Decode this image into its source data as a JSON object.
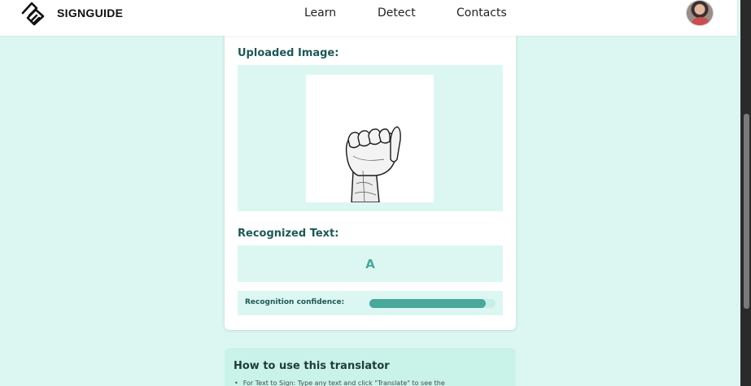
{
  "header": {
    "brand": "SIGNGUIDE",
    "logo_icon": "handshake-logo-icon",
    "nav": [
      {
        "label": "Learn"
      },
      {
        "label": "Detect"
      },
      {
        "label": "Contacts"
      }
    ],
    "avatar_icon": "user-avatar"
  },
  "card": {
    "uploaded_title": "Uploaded Image:",
    "uploaded_image_icon": "asl-letter-a-hand-image",
    "recognized_title": "Recognized Text:",
    "recognized_value": "A",
    "confidence_label": "Recognition confidence:",
    "confidence_fraction": 0.92
  },
  "howto": {
    "title": "How to use this translator",
    "items": [
      "For Text to Sign: Type any text and click \"Translate\" to see the"
    ]
  },
  "colors": {
    "page_bg": "#dcf7f1",
    "accent": "#4aa79b",
    "title_text": "#1e5857",
    "howto_bg": "#c9f3e8"
  }
}
